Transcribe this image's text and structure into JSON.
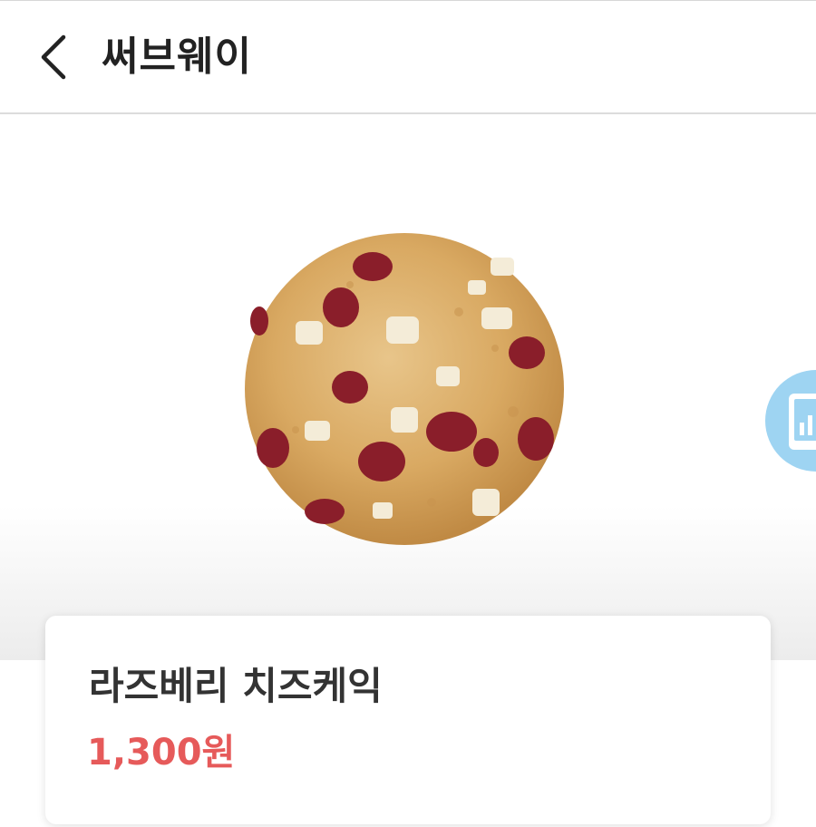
{
  "header": {
    "title": "써브웨이",
    "back_icon": "chevron-left-icon"
  },
  "product": {
    "image_alt": "cookie",
    "name": "라즈베리 치즈케익",
    "price": "1,300원"
  },
  "floating_button": {
    "icon": "tablet-chart-icon"
  },
  "colors": {
    "price": "#e65a5a",
    "floating_button": "#9ed4f2",
    "title_text": "#222222"
  }
}
